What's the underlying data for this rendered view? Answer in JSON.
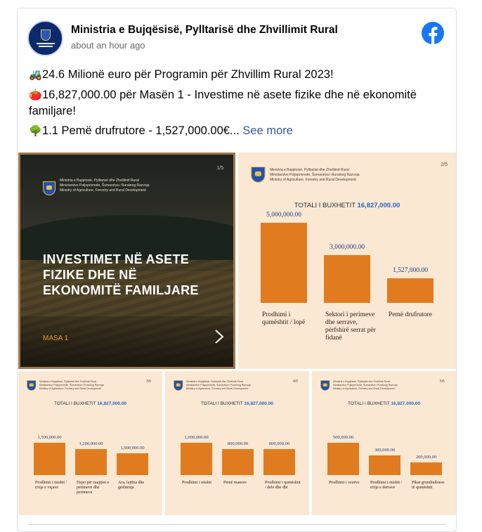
{
  "post": {
    "page_name": "Ministria e Bujqësisë, Pylltarisë dhe Zhvillimit Rural",
    "time": "about an hour ago",
    "lines": [
      {
        "emoji": "🚜",
        "text": "24.6 Milionë euro për Programin për Zhvillim Rural 2023!"
      },
      {
        "emoji": "🍅",
        "text": "16,827,000.00 për Masën 1 - Investime në asete fizike dhe në ekonomitë familjare!"
      },
      {
        "emoji": "🌳",
        "text": "1.1 Pemë drufrutore - 1,527,000.00€..."
      }
    ],
    "see_more": "See more",
    "icons": {
      "brand": "facebook-icon",
      "avatar": "ministry-logo"
    },
    "brand_color": "#1877f2"
  },
  "ministry_lines": [
    "Ministria e Bujqësisë, Pylltarisë dhe Zhvillimit Rural",
    "Ministarstvo Poljoprivrede, Šumarstva i Ruralnog Razvoja",
    "Ministry of Agriculture, Forestry and Rural Development"
  ],
  "slide1": {
    "page": "1/5",
    "title": "INVESTIMET NË ASETE FIZIKE DHE NË EKONOMITË FAMILJARE",
    "subtitle": "MASA 1"
  },
  "chart_data": [
    {
      "type": "bar",
      "page": "2/5",
      "title_prefix": "TOTALI I BUXHETIT",
      "title_value": "16,827,000.00",
      "categories": [
        "Prodhimi i qumështit / lopë",
        "Sektori i perimeve dhe serrave, përfshirë serrat për fidanë",
        "Pemë drufrutore"
      ],
      "value_labels": [
        "5,000,000.00",
        "3,000,000.00",
        "1,527,000.00"
      ],
      "values": [
        5000000,
        3000000,
        1527000
      ]
    },
    {
      "type": "bar",
      "page": "3/5",
      "title_prefix": "TOTALI I BUXHETIT",
      "title_value": "16,827,000.00",
      "categories": [
        "Prodhimi i mishit / rritja e viçave",
        "Depo për ruajtjen e perimeve dhe perimeve",
        "Ara, lajthia dhe gështenja"
      ],
      "value_labels": [
        "1,500,000.00",
        "1,200,000.00",
        "1,000,000.00"
      ],
      "values": [
        1500000,
        1200000,
        1000000
      ]
    },
    {
      "type": "bar",
      "page": "4/5",
      "title_prefix": "TOTALI I BUXHETIT",
      "title_value": "16,827,000.00",
      "categories": [
        "Prodhimi i mishit",
        "Pemë manore",
        "Prodhimi i qumështit / dele dhe dhi"
      ],
      "value_labels": [
        "1,000,000.00",
        "800,000.00",
        "800,000.00"
      ],
      "values": [
        1000000,
        800000,
        800000
      ]
    },
    {
      "type": "bar",
      "page": "5/5",
      "title_prefix": "TOTALI I BUXHETIT",
      "title_value": "16,827,000.00",
      "categories": [
        "Prodhimi i vezëve",
        "Prodhimi i mishit / rritja e derrave",
        "Pikat grumbulluese të qumështit"
      ],
      "value_labels": [
        "500,000.00",
        "300,000.00",
        "200,000.00"
      ],
      "values": [
        500000,
        300000,
        200000
      ]
    }
  ],
  "colors": {
    "bar": "#e07c1f",
    "tile_bg": "#fbe8d3",
    "value_text": "#1c3b78",
    "title_accent": "#2566c0"
  }
}
